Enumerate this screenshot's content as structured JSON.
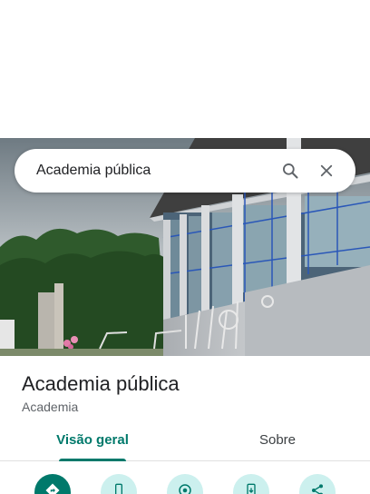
{
  "search": {
    "query": "Academia pública",
    "search_icon": "search-icon",
    "close_icon": "close-icon"
  },
  "place": {
    "name": "Academia pública",
    "category": "Academia"
  },
  "tabs": [
    {
      "label": "Visão geral",
      "active": true
    },
    {
      "label": "Sobre",
      "active": false
    }
  ],
  "actions": [
    {
      "icon": "directions-icon",
      "style": "primary"
    },
    {
      "icon": "phone-icon",
      "style": "secondary"
    },
    {
      "icon": "nearby-icon",
      "style": "secondary"
    },
    {
      "icon": "add-to-phone-icon",
      "style": "secondary"
    },
    {
      "icon": "share-icon",
      "style": "secondary"
    }
  ],
  "colors": {
    "accent": "#00796b",
    "action_secondary_bg": "#ccf0ee",
    "title": "#202124",
    "subtitle": "#5f6368"
  }
}
